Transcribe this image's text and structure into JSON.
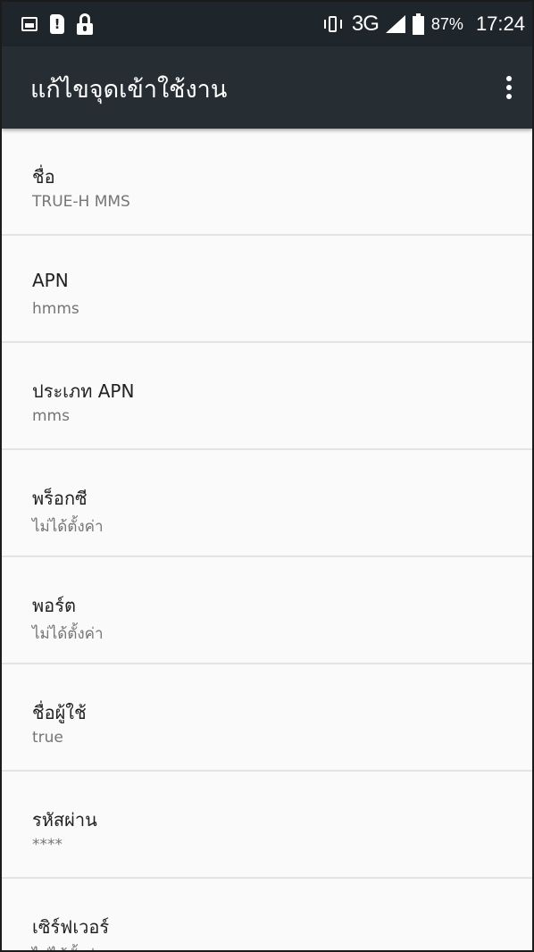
{
  "status_bar": {
    "network_type": "3G",
    "battery_percent": "87%",
    "time": "17:24",
    "left_icons": [
      "image-notification-icon",
      "sim-alert-icon",
      "lock-icon"
    ],
    "right_icons": [
      "vibrate-icon",
      "signal-icon",
      "battery-icon"
    ]
  },
  "app_bar": {
    "title": "แก้ไขจุดเข้าใช้งาน",
    "overflow_icon": "more-vert-icon"
  },
  "settings": [
    {
      "label": "ชื่อ",
      "value": "TRUE-H MMS"
    },
    {
      "label": "APN",
      "value": "hmms"
    },
    {
      "label": "ประเภท APN",
      "value": "mms"
    },
    {
      "label": "พร็อกซี",
      "value": "ไม่ได้ตั้งค่า"
    },
    {
      "label": "พอร์ต",
      "value": "ไม่ได้ตั้งค่า"
    },
    {
      "label": "ชื่อผู้ใช้",
      "value": "true"
    },
    {
      "label": "รหัสผ่าน",
      "value": "****"
    },
    {
      "label": "เซิร์ฟเวอร์",
      "value": "ไม่ได้ตั้งค่า"
    }
  ],
  "colors": {
    "status_bar_bg": "#1f262b",
    "app_bar_bg": "#262e34",
    "list_bg": "#fafafa",
    "divider": "#e3e3e3",
    "title_text": "#212121",
    "secondary_text": "#757575"
  }
}
